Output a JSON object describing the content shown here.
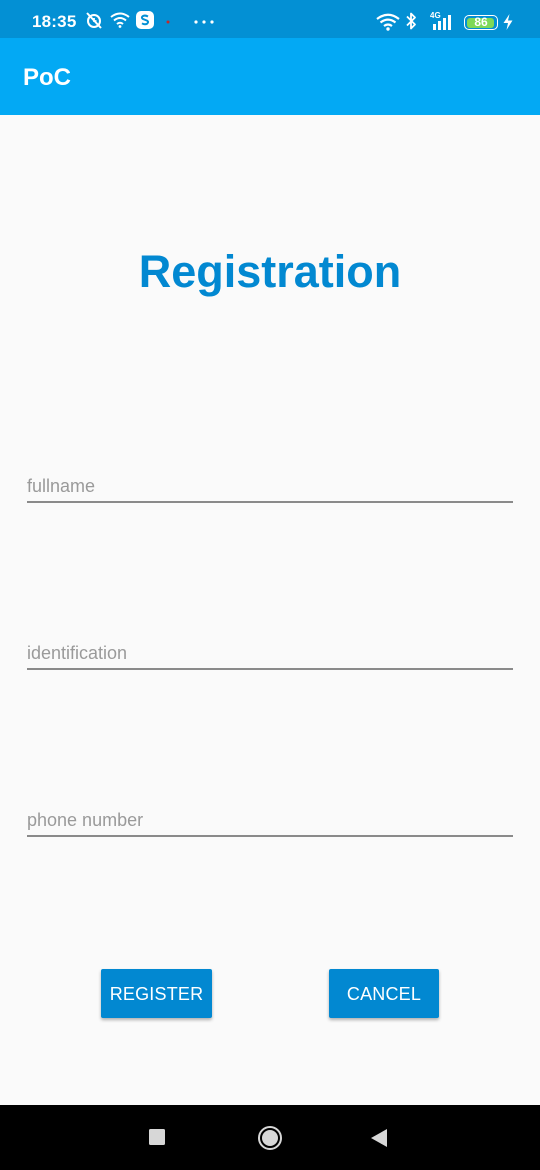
{
  "status_bar": {
    "time": "18:35",
    "network_type": "4G",
    "battery_level": "86",
    "icons": [
      "alarm-off-icon",
      "wifi-icon",
      "skype-icon",
      "more-icon",
      "wifi-icon",
      "bluetooth-icon",
      "signal-icon",
      "battery-icon",
      "charging-icon"
    ]
  },
  "app_bar": {
    "title": "PoC"
  },
  "form": {
    "heading": "Registration",
    "fullname_placeholder": "fullname",
    "identification_placeholder": "identification",
    "phone_placeholder": "phone number",
    "register_label": "REGISTER",
    "cancel_label": "CANCEL"
  },
  "nav_bar": {
    "icons": [
      "recent-apps-icon",
      "home-icon",
      "back-icon"
    ]
  },
  "colors": {
    "status_bar": "#0390d4",
    "app_bar": "#03a9f4",
    "accent": "#0288d1",
    "background": "#fafafa",
    "battery_fill": "#7ed957"
  }
}
